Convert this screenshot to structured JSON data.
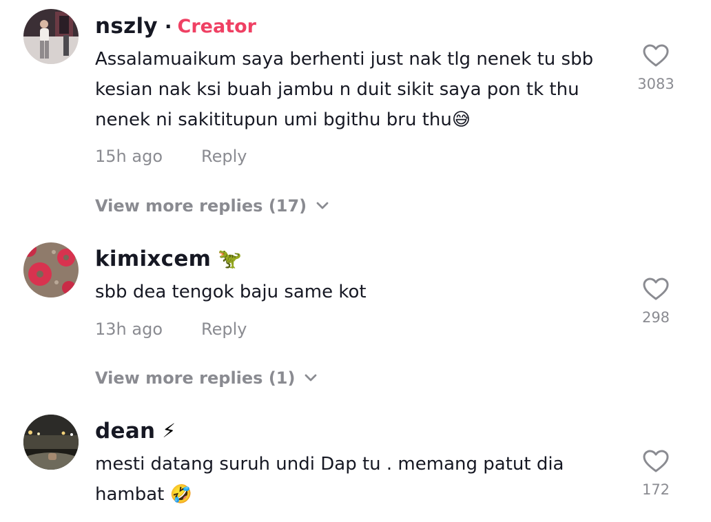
{
  "comments": [
    {
      "username": "nszly",
      "separator": "·",
      "creator_label": "Creator",
      "badge": "",
      "text": "Assalamuaikum saya berhenti just nak tlg nenek tu sbb kesian nak ksi buah jambu n duit sikit saya pon tk thu nenek ni sakititupun umi bgithu bru thu",
      "emoji": "😅",
      "time": "15h ago",
      "reply_label": "Reply",
      "likes": "3083",
      "view_more": "View more replies (17)"
    },
    {
      "username": "kimixcem",
      "badge": "🦖",
      "text": "sbb dea tengok baju same kot",
      "emoji": "",
      "time": "13h ago",
      "reply_label": "Reply",
      "likes": "298",
      "view_more": "View more replies (1)"
    },
    {
      "username": "dean",
      "badge": "⚡",
      "text": "mesti datang suruh undi Dap tu . memang patut dia hambat",
      "emoji": "🤣",
      "likes": "172"
    }
  ],
  "colors": {
    "text_primary": "#161823",
    "text_secondary": "#8a8b91",
    "creator_accent": "#ef4063"
  },
  "icons": {
    "like": "heart-outline-icon",
    "expand": "chevron-down-icon"
  }
}
